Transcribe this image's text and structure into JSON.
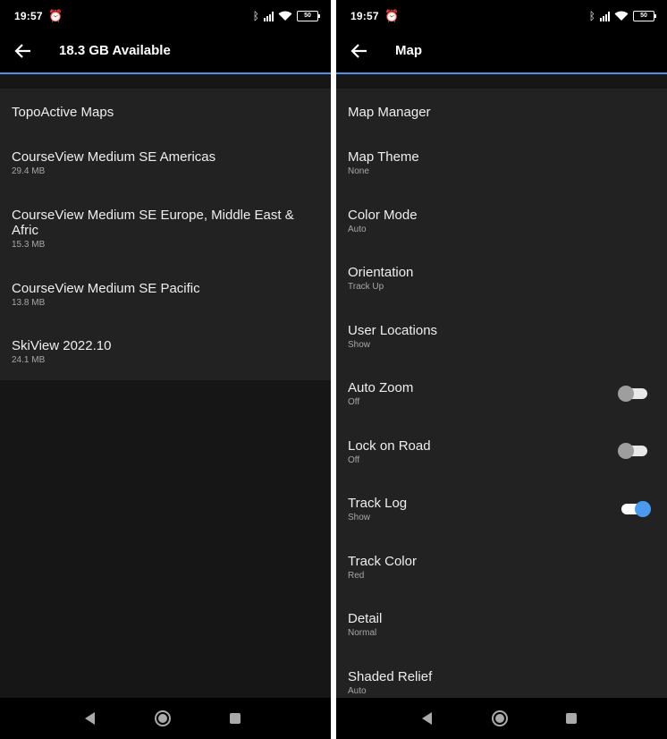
{
  "status_bar": {
    "time": "19:57",
    "battery": "50",
    "icons": [
      "alarm-off-icon",
      "bluetooth-icon",
      "signal-icon",
      "wifi-icon",
      "battery-icon"
    ]
  },
  "left_screen": {
    "title": "18.3 GB Available",
    "items": [
      {
        "title": "TopoActive Maps",
        "subtitle": ""
      },
      {
        "title": "CourseView Medium SE Americas",
        "subtitle": "29.4 MB"
      },
      {
        "title": "CourseView Medium SE Europe, Middle East & Afric",
        "subtitle": "15.3 MB"
      },
      {
        "title": "CourseView Medium SE Pacific",
        "subtitle": "13.8 MB"
      },
      {
        "title": "SkiView 2022.10",
        "subtitle": "24.1 MB"
      }
    ]
  },
  "right_screen": {
    "title": "Map",
    "items": [
      {
        "title": "Map Manager",
        "subtitle": ""
      },
      {
        "title": "Map Theme",
        "subtitle": "None"
      },
      {
        "title": "Color Mode",
        "subtitle": "Auto"
      },
      {
        "title": "Orientation",
        "subtitle": "Track Up"
      },
      {
        "title": "User Locations",
        "subtitle": "Show"
      },
      {
        "title": "Auto Zoom",
        "subtitle": "Off",
        "toggle": false
      },
      {
        "title": "Lock on Road",
        "subtitle": "Off",
        "toggle": false
      },
      {
        "title": "Track Log",
        "subtitle": "Show",
        "toggle": true
      },
      {
        "title": "Track Color",
        "subtitle": "Red"
      },
      {
        "title": "Detail",
        "subtitle": "Normal"
      },
      {
        "title": "Shaded Relief",
        "subtitle": "Auto"
      }
    ]
  },
  "colors": {
    "accent": "#4f8fe8",
    "toggle_on": "#4a9bf0",
    "background": "#161616",
    "list_background": "#222222"
  }
}
